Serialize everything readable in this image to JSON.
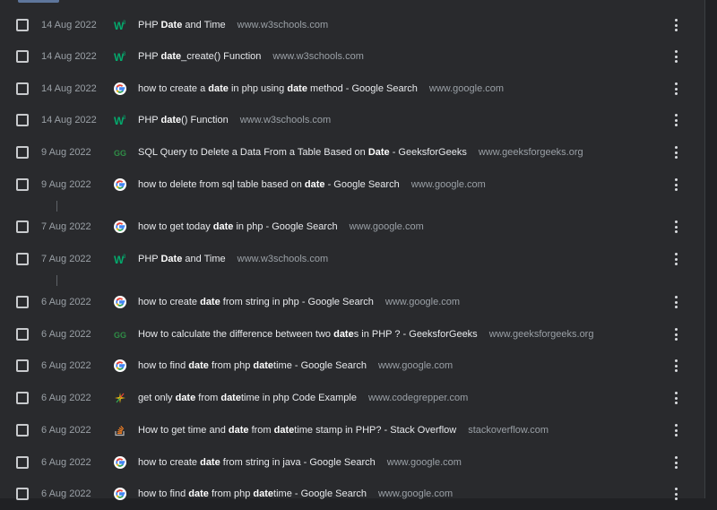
{
  "history": [
    {
      "date": "14 Aug 2022",
      "icon": "w3schools-icon",
      "parts": [
        [
          "PHP ",
          false
        ],
        [
          "Date",
          true
        ],
        [
          " and Time",
          false
        ]
      ],
      "domain": "www.w3schools.com"
    },
    {
      "date": "14 Aug 2022",
      "icon": "w3schools-icon",
      "parts": [
        [
          "PHP ",
          false
        ],
        [
          "date",
          true
        ],
        [
          "_create() Function",
          false
        ]
      ],
      "domain": "www.w3schools.com"
    },
    {
      "date": "14 Aug 2022",
      "icon": "google-icon",
      "parts": [
        [
          "how to create a ",
          false
        ],
        [
          "date",
          true
        ],
        [
          " in php using ",
          false
        ],
        [
          "date",
          true
        ],
        [
          " method - Google Search",
          false
        ]
      ],
      "domain": "www.google.com"
    },
    {
      "date": "14 Aug 2022",
      "icon": "w3schools-icon",
      "parts": [
        [
          "PHP ",
          false
        ],
        [
          "date",
          true
        ],
        [
          "() Function",
          false
        ]
      ],
      "domain": "www.w3schools.com"
    },
    {
      "date": "9 Aug 2022",
      "icon": "geeksforgeeks-icon",
      "parts": [
        [
          "SQL Query to Delete a Data From a Table Based on ",
          false
        ],
        [
          "Date",
          true
        ],
        [
          " - GeeksforGeeks",
          false
        ]
      ],
      "domain": "www.geeksforgeeks.org"
    },
    {
      "date": "9 Aug 2022",
      "icon": "google-icon",
      "parts": [
        [
          "how to delete from sql table based on ",
          false
        ],
        [
          "date",
          true
        ],
        [
          " - Google Search",
          false
        ]
      ],
      "domain": "www.google.com"
    },
    {
      "date": "7 Aug 2022",
      "icon": "google-icon",
      "parts": [
        [
          "how to get today ",
          false
        ],
        [
          "date",
          true
        ],
        [
          " in php - Google Search",
          false
        ]
      ],
      "domain": "www.google.com"
    },
    {
      "date": "7 Aug 2022",
      "icon": "w3schools-icon",
      "parts": [
        [
          "PHP ",
          false
        ],
        [
          "Date",
          true
        ],
        [
          " and Time",
          false
        ]
      ],
      "domain": "www.w3schools.com"
    },
    {
      "date": "6 Aug 2022",
      "icon": "google-icon",
      "parts": [
        [
          "how to create ",
          false
        ],
        [
          "date",
          true
        ],
        [
          " from string in php - Google Search",
          false
        ]
      ],
      "domain": "www.google.com"
    },
    {
      "date": "6 Aug 2022",
      "icon": "geeksforgeeks-icon",
      "parts": [
        [
          "How to calculate the difference between two ",
          false
        ],
        [
          "date",
          true
        ],
        [
          "s in PHP ? - GeeksforGeeks",
          false
        ]
      ],
      "domain": "www.geeksforgeeks.org"
    },
    {
      "date": "6 Aug 2022",
      "icon": "google-icon",
      "parts": [
        [
          "how to find ",
          false
        ],
        [
          "date",
          true
        ],
        [
          " from php ",
          false
        ],
        [
          "date",
          true
        ],
        [
          "time - Google Search",
          false
        ]
      ],
      "domain": "www.google.com"
    },
    {
      "date": "6 Aug 2022",
      "icon": "codegrepper-icon",
      "parts": [
        [
          "get only ",
          false
        ],
        [
          "date",
          true
        ],
        [
          " from ",
          false
        ],
        [
          "date",
          true
        ],
        [
          "time in php Code Example",
          false
        ]
      ],
      "domain": "www.codegrepper.com"
    },
    {
      "date": "6 Aug 2022",
      "icon": "stackoverflow-icon",
      "parts": [
        [
          "How to get time and ",
          false
        ],
        [
          "date",
          true
        ],
        [
          " from ",
          false
        ],
        [
          "date",
          true
        ],
        [
          "time stamp in PHP? - Stack Overflow",
          false
        ]
      ],
      "domain": "stackoverflow.com"
    },
    {
      "date": "6 Aug 2022",
      "icon": "google-icon",
      "parts": [
        [
          "how to create ",
          false
        ],
        [
          "date",
          true
        ],
        [
          " from string in java - Google Search",
          false
        ]
      ],
      "domain": "www.google.com"
    },
    {
      "date": "6 Aug 2022",
      "icon": "google-icon",
      "parts": [
        [
          "how to find ",
          false
        ],
        [
          "date",
          true
        ],
        [
          " from php ",
          false
        ],
        [
          "date",
          true
        ],
        [
          "time - Google Search",
          false
        ]
      ],
      "domain": "www.google.com"
    }
  ],
  "colors": {
    "background": "#292a2d",
    "text": "#e8eaed",
    "muted": "#9aa0a6"
  }
}
